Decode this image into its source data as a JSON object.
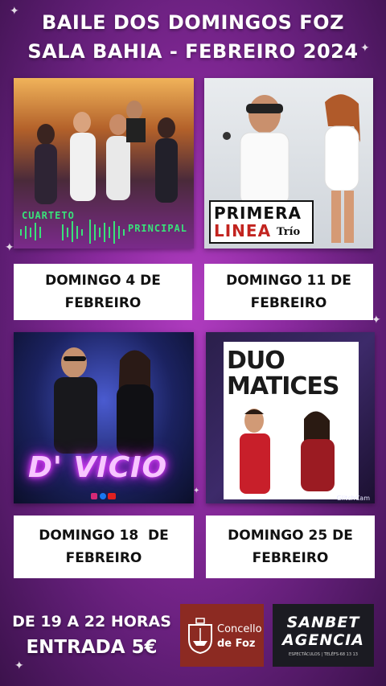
{
  "header": {
    "line1": "BAILE DOS DOMINGOS FOZ",
    "line2": "SALA BAHIA - FEBREIRO 2024"
  },
  "events": [
    {
      "band_line1": "CUARTETO",
      "band_line2": "PRINCIPAL",
      "date_line1": "DOMINGO 4 DE",
      "date_line2": "FEBREIRO"
    },
    {
      "band_line1": "PRIMERA",
      "band_line2": "LINEA",
      "band_extra": "Trío",
      "date_line1": "DOMINGO 11 DE",
      "date_line2": "FEBREIRO"
    },
    {
      "band_line1": "D' VICIO",
      "date_line1": "DOMINGO 18  DE",
      "date_line2": "FEBREIRO"
    },
    {
      "band_line1": "DUO",
      "band_line2": "MATICES",
      "band_extra": "GlitchCam",
      "date_line1": "DOMINGO 25 DE",
      "date_line2": "FEBREIRO"
    }
  ],
  "footer": {
    "hours": "DE 19 A 22 HORAS",
    "price": "ENTRADA 5€",
    "concello_line1": "Concello",
    "concello_line2": "de Foz",
    "agency_line1": "SANBET",
    "agency_line2": "AGENCIA",
    "agency_tagline": "ESPECTÁCULOS | TELÉFS-68 13 13"
  },
  "colors": {
    "bg_center": "#b03cc0",
    "bg_edge": "#3c124c",
    "concello_red": "#8c2a22",
    "agency_dark": "#1b1b22",
    "neon_green": "#39e27a",
    "neon_pink": "#e040ff"
  }
}
